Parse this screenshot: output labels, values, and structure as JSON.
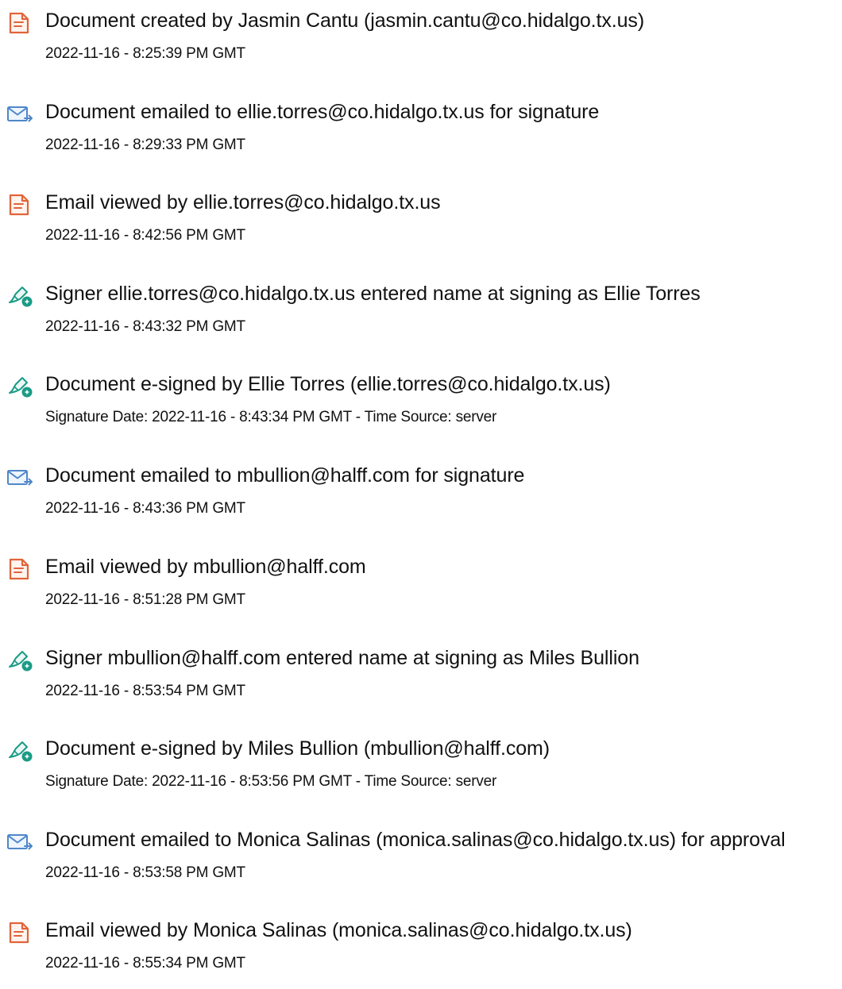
{
  "colors": {
    "document_icon": "#e0643a",
    "email_icon": "#4f87c8",
    "sign_icon": "#1a9b86",
    "text": "#111111"
  },
  "events": [
    {
      "icon": "document-icon",
      "title": "Document created by Jasmin Cantu (jasmin.cantu@co.hidalgo.tx.us)",
      "detail": "2022-11-16 - 8:25:39 PM GMT"
    },
    {
      "icon": "email-icon",
      "title": "Document emailed to ellie.torres@co.hidalgo.tx.us for signature",
      "detail": "2022-11-16 - 8:29:33 PM GMT"
    },
    {
      "icon": "document-icon",
      "title": "Email viewed by ellie.torres@co.hidalgo.tx.us",
      "detail": "2022-11-16 - 8:42:56 PM GMT"
    },
    {
      "icon": "sign-icon",
      "title": "Signer ellie.torres@co.hidalgo.tx.us entered name at signing as Ellie Torres",
      "detail": "2022-11-16 - 8:43:32 PM GMT"
    },
    {
      "icon": "sign-icon",
      "title": "Document e-signed by Ellie Torres (ellie.torres@co.hidalgo.tx.us)",
      "detail": "Signature Date: 2022-11-16 - 8:43:34 PM GMT - Time Source: server"
    },
    {
      "icon": "email-icon",
      "title": "Document emailed to mbullion@halff.com for signature",
      "detail": "2022-11-16 - 8:43:36 PM GMT"
    },
    {
      "icon": "document-icon",
      "title": "Email viewed by mbullion@halff.com",
      "detail": "2022-11-16 - 8:51:28 PM GMT"
    },
    {
      "icon": "sign-icon",
      "title": "Signer mbullion@halff.com entered name at signing as Miles Bullion",
      "detail": "2022-11-16 - 8:53:54 PM GMT"
    },
    {
      "icon": "sign-icon",
      "title": "Document e-signed by Miles Bullion (mbullion@halff.com)",
      "detail": "Signature Date: 2022-11-16 - 8:53:56 PM GMT - Time Source: server"
    },
    {
      "icon": "email-icon",
      "title": "Document emailed to Monica Salinas (monica.salinas@co.hidalgo.tx.us) for approval",
      "detail": "2022-11-16 - 8:53:58 PM GMT"
    },
    {
      "icon": "document-icon",
      "title": "Email viewed by Monica Salinas (monica.salinas@co.hidalgo.tx.us)",
      "detail": "2022-11-16 - 8:55:34 PM GMT"
    }
  ]
}
